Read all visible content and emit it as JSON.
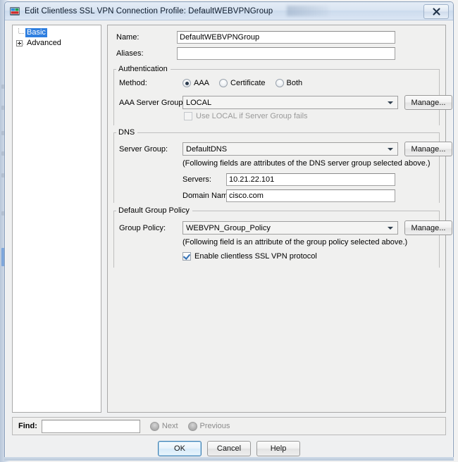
{
  "window": {
    "title": "Edit Clientless SSL VPN Connection Profile: DefaultWEBVPNGroup",
    "app_icon": "asdm-app-icon",
    "close_label": "✖"
  },
  "tree": {
    "items": [
      {
        "label": "Basic",
        "selected": true,
        "expandable": false
      },
      {
        "label": "Advanced",
        "selected": false,
        "expandable": true
      }
    ]
  },
  "form": {
    "name_label": "Name:",
    "name_value": "DefaultWEBVPNGroup",
    "aliases_label": "Aliases:",
    "aliases_value": "",
    "aliases_placeholder": ""
  },
  "authentication": {
    "group_label": "Authentication",
    "method_label": "Method:",
    "methods": [
      {
        "label": "AAA",
        "selected": true
      },
      {
        "label": "Certificate",
        "selected": false
      },
      {
        "label": "Both",
        "selected": false
      }
    ],
    "server_group_label": "AAA Server Group:",
    "server_group_value": "LOCAL",
    "manage_label": "Manage...",
    "use_local_label": "Use LOCAL if Server Group fails",
    "use_local_checked": false,
    "use_local_enabled": false
  },
  "dns": {
    "group_label": "DNS",
    "server_group_label": "Server Group:",
    "server_group_value": "DefaultDNS",
    "manage_label": "Manage...",
    "note": "(Following fields are attributes of the DNS server group selected above.)",
    "servers_label": "Servers:",
    "servers_value": "10.21.22.101",
    "domain_label": "Domain Name:",
    "domain_value": "cisco.com"
  },
  "group_policy": {
    "group_label": "Default Group Policy",
    "policy_label": "Group Policy:",
    "policy_value": "WEBVPN_Group_Policy",
    "manage_label": "Manage...",
    "note": "(Following field is an attribute of the group policy selected above.)",
    "enable_label": "Enable clientless SSL VPN protocol",
    "enable_checked": true
  },
  "find": {
    "label": "Find:",
    "value": "",
    "placeholder": "",
    "next_label": "Next",
    "previous_label": "Previous"
  },
  "footer": {
    "ok_label": "OK",
    "cancel_label": "Cancel",
    "help_label": "Help"
  },
  "colors": {
    "selection_blue": "#2f7fe0",
    "title_bar": "#dae5f2",
    "panel_bg": "#f0f0ef",
    "default_button_border": "#3c7fb1"
  }
}
